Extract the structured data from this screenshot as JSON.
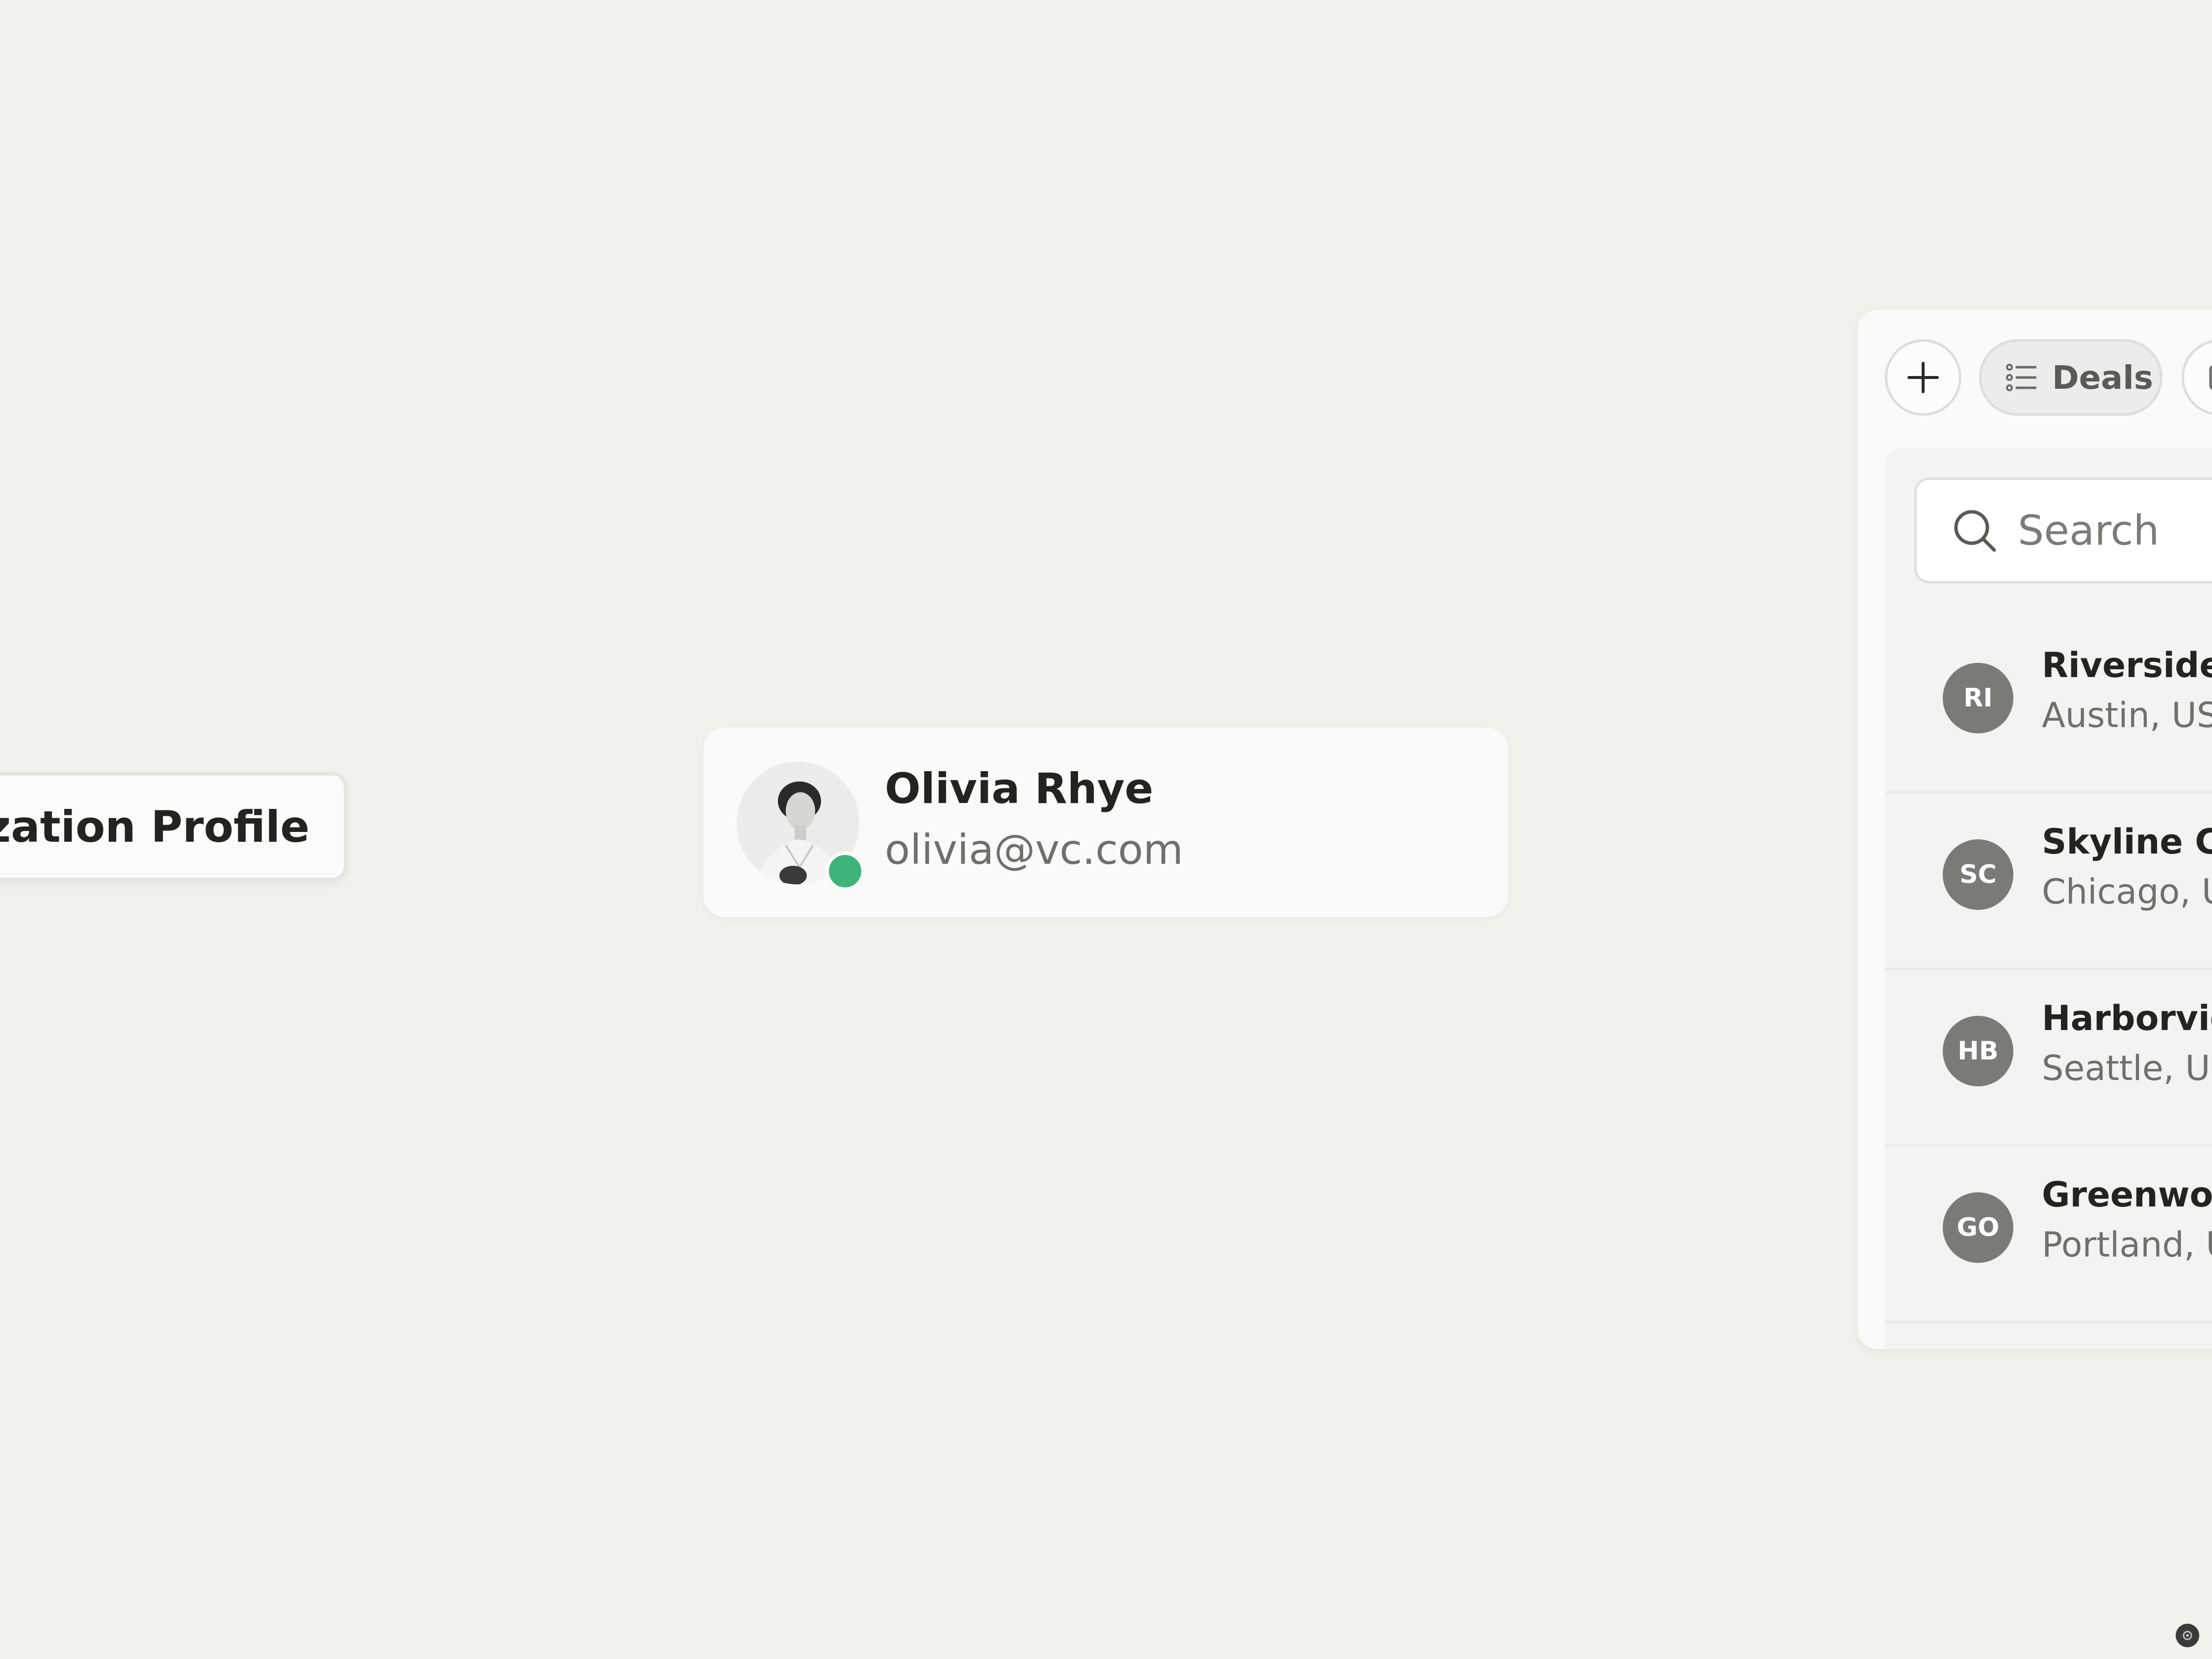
{
  "org_button": {
    "label": "nization Profile"
  },
  "user_card": {
    "name": "Olivia Rhye",
    "email": "olivia@vc.com",
    "status": "online",
    "status_color": "#3fb47a"
  },
  "panel": {
    "add_icon": "plus-icon",
    "tabs": [
      {
        "label": "Deals",
        "icon": "list-icon",
        "active": true
      }
    ],
    "search": {
      "placeholder": "Search",
      "icon": "search-icon"
    },
    "companies": [
      {
        "initials": "RI",
        "name": "Riverside",
        "location": "Austin, US"
      },
      {
        "initials": "SC",
        "name": "Skyline Co",
        "location": "Chicago, U"
      },
      {
        "initials": "HB",
        "name": "Harborvie",
        "location": "Seattle, US"
      },
      {
        "initials": "GO",
        "name": "Greenwoo",
        "location": "Portland, U"
      }
    ],
    "avatar_color": "#7a7a77"
  },
  "colors": {
    "background": "#f0f2ec",
    "card": "#fafaf9",
    "text_primary": "#23231f",
    "text_secondary": "#6f706c"
  }
}
